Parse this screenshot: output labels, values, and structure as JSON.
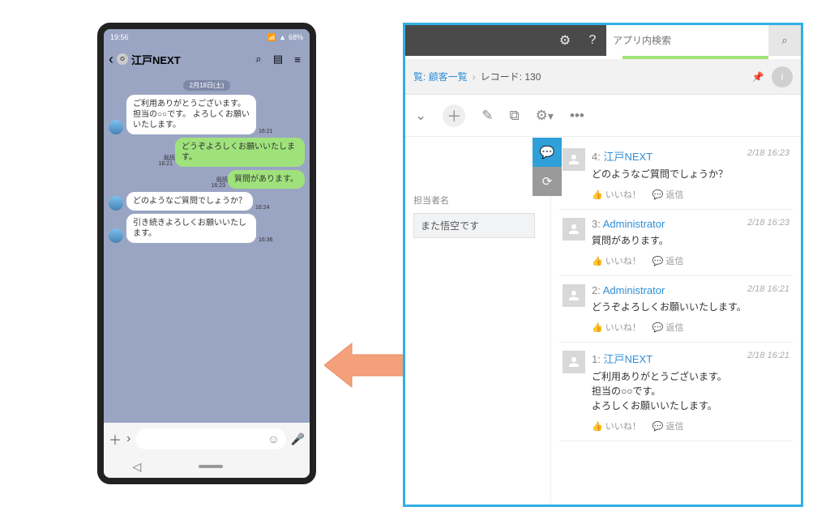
{
  "phone": {
    "status": {
      "time": "19:56",
      "carrier_icon": "📶",
      "battery": "68%"
    },
    "chat": {
      "title": "江戸NEXT",
      "date": "2月18日(土)",
      "messages": [
        {
          "side": "left",
          "avatar": true,
          "text": "ご利用ありがとうございます。\n担当の○○です。\nよろしくお願いいたします。",
          "time": "16:21",
          "read": ""
        },
        {
          "side": "right",
          "avatar": false,
          "text": "どうぞよろしくお願いいたします。",
          "time": "16:21",
          "read": "既読"
        },
        {
          "side": "right",
          "avatar": false,
          "text": "質問があります。",
          "time": "16:23",
          "read": "既読"
        },
        {
          "side": "left",
          "avatar": true,
          "text": "どのようなご質問でしょうか？",
          "time": "16:24",
          "read": ""
        },
        {
          "side": "left",
          "avatar": true,
          "text": "引き続きよろしくお願いいたします。",
          "time": "16:36",
          "read": ""
        }
      ]
    }
  },
  "panel": {
    "search_placeholder": "アプリ内検索",
    "breadcrumb_link": "覧: 顧客一覧",
    "record_label": "レコード: 130",
    "side_field": {
      "label": "担当者名",
      "value": "また悟空です"
    },
    "actions": {
      "like": "いいね！",
      "reply": "返信"
    },
    "comments": [
      {
        "num": "4",
        "name": "江戸NEXT",
        "name_color": "blue",
        "date": "2/18 16:23",
        "body": "どのようなご質問でしょうか？"
      },
      {
        "num": "3",
        "name": "Administrator",
        "name_color": "blue",
        "date": "2/18 16:23",
        "body": "質問があります。"
      },
      {
        "num": "2",
        "name": "Administrator",
        "name_color": "blue",
        "date": "2/18 16:21",
        "body": "どうぞよろしくお願いいたします。"
      },
      {
        "num": "1",
        "name": "江戸NEXT",
        "name_color": "blue",
        "date": "2/18 16:21",
        "body": "ご利用ありがとうございます。\n担当の○○です。\nよろしくお願いいたします。"
      }
    ]
  }
}
